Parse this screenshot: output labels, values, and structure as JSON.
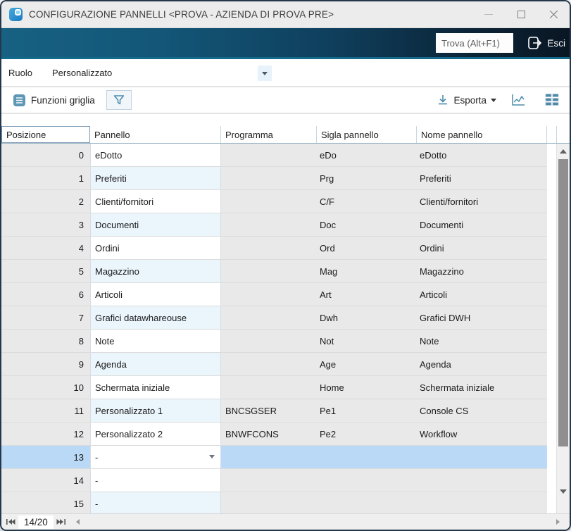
{
  "window": {
    "title": "CONFIGURAZIONE PANNELLI <PROVA - AZIENDA DI PROVA PRE>"
  },
  "topbar": {
    "find_placeholder": "Trova (Alt+F1)",
    "exit_label": "Esci"
  },
  "role": {
    "label": "Ruolo",
    "value": "Personalizzato"
  },
  "toolbar": {
    "grid_functions_label": "Funzioni griglia",
    "export_label": "Esporta"
  },
  "table": {
    "columns": {
      "posizione": "Posizione",
      "pannello": "Pannello",
      "programma": "Programma",
      "sigla": "Sigla pannello",
      "nome": "Nome pannello"
    },
    "selected_row_index": 13,
    "rows": [
      {
        "posizione": "0",
        "pannello": "eDotto",
        "programma": "",
        "sigla": "eDo",
        "nome": "eDotto"
      },
      {
        "posizione": "1",
        "pannello": "Preferiti",
        "programma": "",
        "sigla": "Prg",
        "nome": "Preferiti"
      },
      {
        "posizione": "2",
        "pannello": "Clienti/fornitori",
        "programma": "",
        "sigla": "C/F",
        "nome": "Clienti/fornitori"
      },
      {
        "posizione": "3",
        "pannello": "Documenti",
        "programma": "",
        "sigla": "Doc",
        "nome": "Documenti"
      },
      {
        "posizione": "4",
        "pannello": "Ordini",
        "programma": "",
        "sigla": "Ord",
        "nome": "Ordini"
      },
      {
        "posizione": "5",
        "pannello": "Magazzino",
        "programma": "",
        "sigla": "Mag",
        "nome": "Magazzino"
      },
      {
        "posizione": "6",
        "pannello": "Articoli",
        "programma": "",
        "sigla": "Art",
        "nome": "Articoli"
      },
      {
        "posizione": "7",
        "pannello": "Grafici datawhareouse",
        "programma": "",
        "sigla": "Dwh",
        "nome": "Grafici DWH"
      },
      {
        "posizione": "8",
        "pannello": "Note",
        "programma": "",
        "sigla": "Not",
        "nome": "Note"
      },
      {
        "posizione": "9",
        "pannello": "Agenda",
        "programma": "",
        "sigla": "Age",
        "nome": "Agenda"
      },
      {
        "posizione": "10",
        "pannello": "Schermata iniziale",
        "programma": "",
        "sigla": "Home",
        "nome": "Schermata iniziale"
      },
      {
        "posizione": "11",
        "pannello": "Personalizzato 1",
        "programma": "BNCSGSER",
        "sigla": "Pe1",
        "nome": "Console CS"
      },
      {
        "posizione": "12",
        "pannello": "Personalizzato 2",
        "programma": "BNWFCONS",
        "sigla": "Pe2",
        "nome": "Workflow"
      },
      {
        "posizione": "13",
        "pannello": "-",
        "programma": "",
        "sigla": "",
        "nome": ""
      },
      {
        "posizione": "14",
        "pannello": "-",
        "programma": "",
        "sigla": "",
        "nome": ""
      },
      {
        "posizione": "15",
        "pannello": "-",
        "programma": "",
        "sigla": "",
        "nome": ""
      }
    ]
  },
  "statusbar": {
    "pager": "14/20"
  },
  "colors": {
    "accent_icon": "#4b8bab",
    "selection": "#b9d9f7",
    "row_alt": "#eaf5fc",
    "grey_cell": "#e9e9e9",
    "darkbar_left": "#176183",
    "darkbar_right": "#0a1624"
  }
}
